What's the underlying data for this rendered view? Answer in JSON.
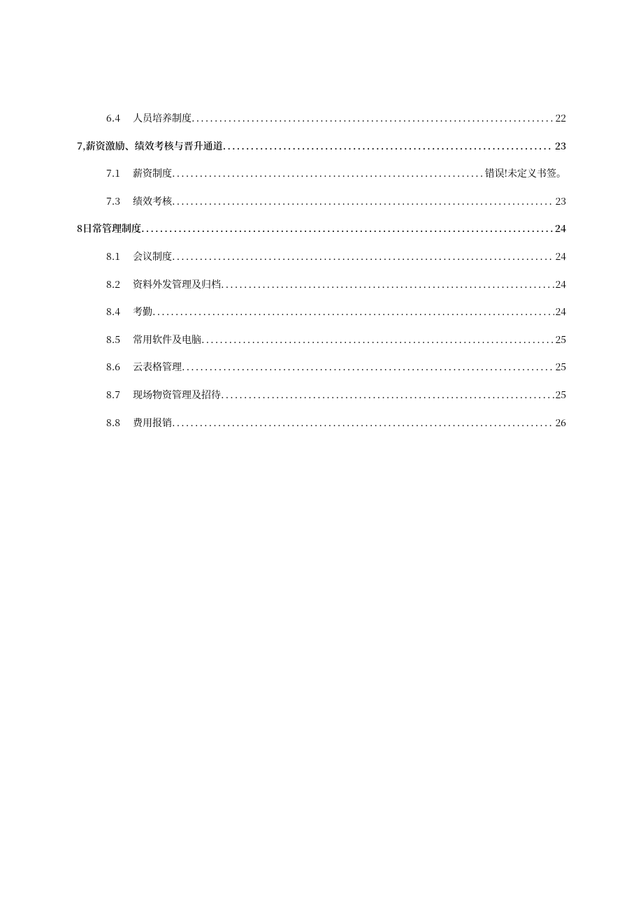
{
  "toc": [
    {
      "level": "lv2",
      "num": "6.4",
      "title": "人员培养制度",
      "page": "22"
    },
    {
      "level": "lv1",
      "num": "7,",
      "title": "薪资激励、绩效考核与晋升通道",
      "page": "23"
    },
    {
      "level": "lv2",
      "num": "7.1",
      "title": "薪资制度",
      "page": "错误!未定义书签。"
    },
    {
      "level": "lv2",
      "num": "7.3",
      "title": "绩效考核",
      "page": "23"
    },
    {
      "level": "lv1",
      "num": "8",
      "title": "日常管理制度",
      "page": "24"
    },
    {
      "level": "lv2",
      "num": "8.1",
      "title": "会议制度",
      "page": "24"
    },
    {
      "level": "lv2",
      "num": "8.2",
      "title": "资料外发管理及归档",
      "page": "24"
    },
    {
      "level": "lv2",
      "num": "8.4",
      "title": "考勤",
      "page": "24"
    },
    {
      "level": "lv2",
      "num": "8.5",
      "title": "常用软件及电脑",
      "page": "25"
    },
    {
      "level": "lv2",
      "num": "8.6",
      "title": "云表格管理",
      "page": "25"
    },
    {
      "level": "lv2",
      "num": "8.7",
      "title": "现场物资管理及招待",
      "page": "25"
    },
    {
      "level": "lv2",
      "num": "8.8",
      "title": "费用报销",
      "page": "26"
    }
  ]
}
